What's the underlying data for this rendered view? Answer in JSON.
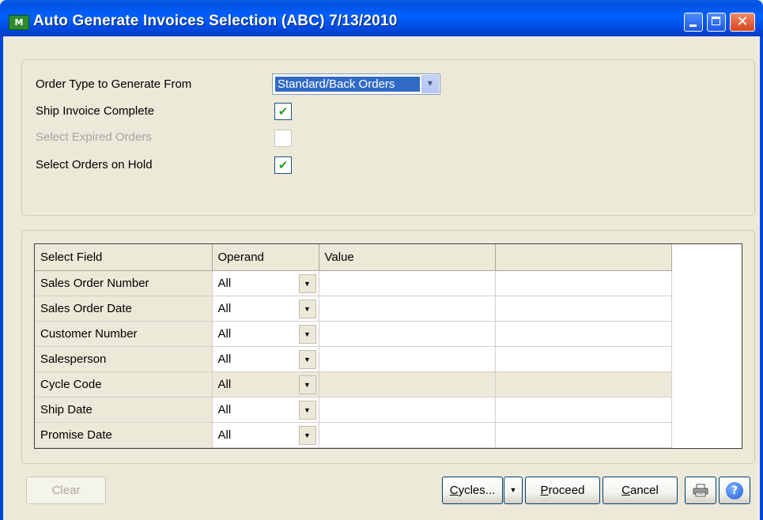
{
  "window": {
    "app_icon_text": "M",
    "title": "Auto Generate Invoices Selection (ABC) 7/13/2010",
    "min_icon": "minimize-icon",
    "max_icon": "maximize-icon",
    "close_icon": "close-icon",
    "close_glyph": "✕"
  },
  "options": {
    "order_type_label": "Order Type to Generate From",
    "order_type_value": "Standard/Back Orders",
    "ship_invoice_label": "Ship Invoice Complete",
    "ship_invoice_checked": true,
    "expired_label": "Select Expired Orders",
    "expired_checked": false,
    "expired_enabled": false,
    "on_hold_label": "Select Orders on Hold",
    "on_hold_checked": true,
    "check_glyph": "✔",
    "dropdown_glyph": "▼"
  },
  "grid": {
    "headers": [
      "Select Field",
      "Operand",
      "Value",
      ""
    ],
    "rows": [
      {
        "field": "Sales Order Number",
        "operand": "All",
        "value": ""
      },
      {
        "field": "Sales Order Date",
        "operand": "All",
        "value": ""
      },
      {
        "field": "Customer Number",
        "operand": "All",
        "value": ""
      },
      {
        "field": "Salesperson",
        "operand": "All",
        "value": ""
      },
      {
        "field": "Cycle Code",
        "operand": "All",
        "value": ""
      },
      {
        "field": "Ship Date",
        "operand": "All",
        "value": ""
      },
      {
        "field": "Promise Date",
        "operand": "All",
        "value": ""
      }
    ],
    "operand_btn_glyph": "▼"
  },
  "buttons": {
    "clear": "Clear",
    "cycles_u": "C",
    "cycles_rest": "ycles...",
    "cycles_drop": "▼",
    "proceed_u": "P",
    "proceed_rest": "roceed",
    "cancel_u": "C",
    "cancel_rest": "ancel",
    "print_icon": "printer-icon",
    "help_icon": "help-icon",
    "help_glyph": "?"
  }
}
